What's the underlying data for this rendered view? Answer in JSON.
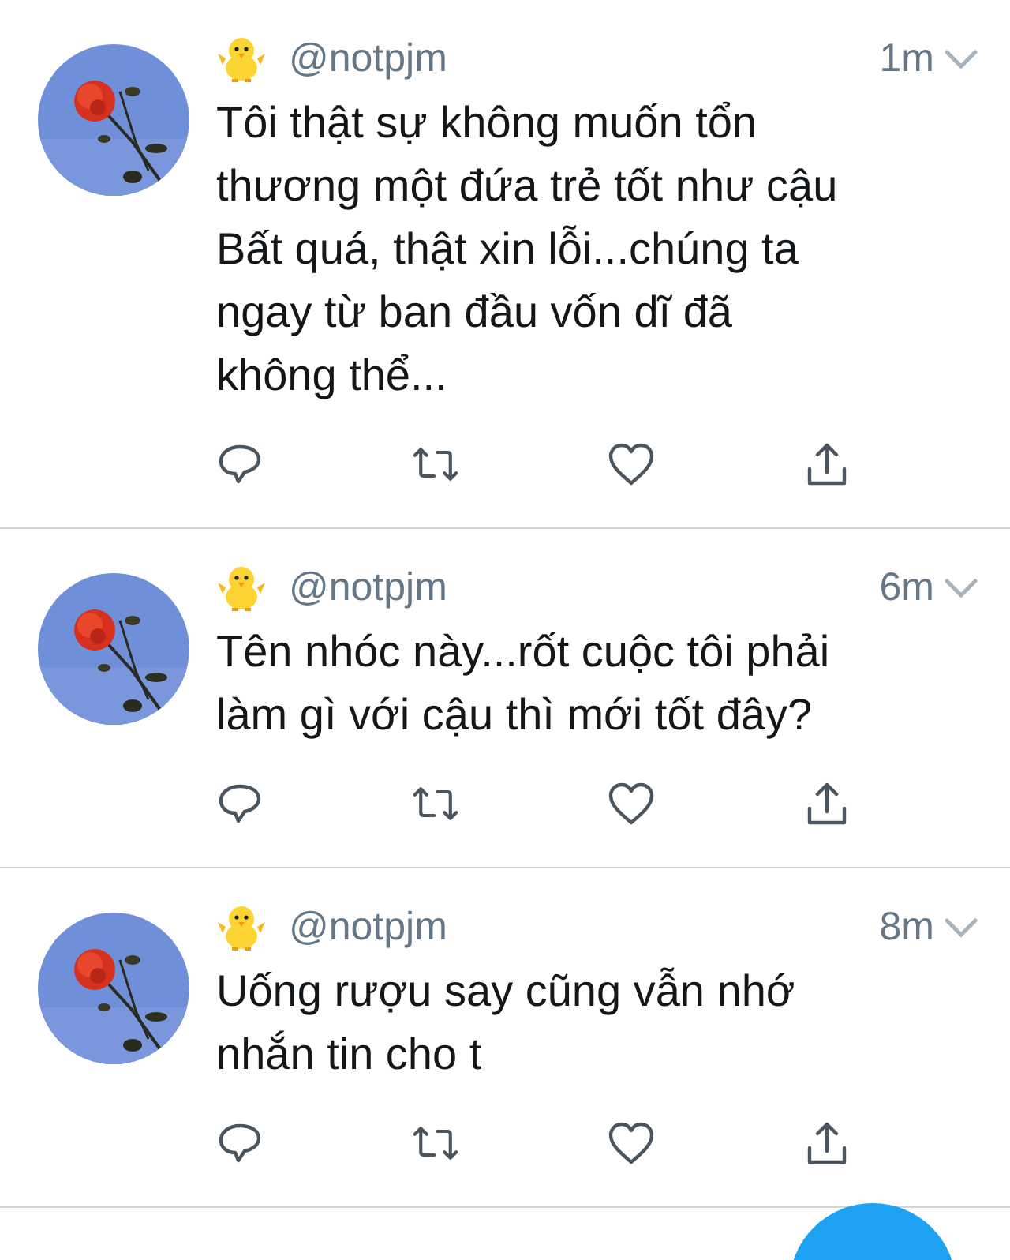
{
  "tweets": [
    {
      "handle": "@notpjm",
      "time": "1m",
      "text": "Tôi thật sự không muốn tổn\nthương một đứa trẻ tốt như cậu\nBất quá, thật xin lỗi...chúng ta\nngay từ ban đầu vốn dĩ đã\nkhông thể..."
    },
    {
      "handle": "@notpjm",
      "time": "6m",
      "text": "Tên nhóc này...rốt cuộc tôi phải\nlàm gì với cậu thì mới tốt đây?"
    },
    {
      "handle": "@notpjm",
      "time": "8m",
      "text": "Uống rượu say cũng vẫn nhớ\nnhắn tin cho t"
    }
  ]
}
